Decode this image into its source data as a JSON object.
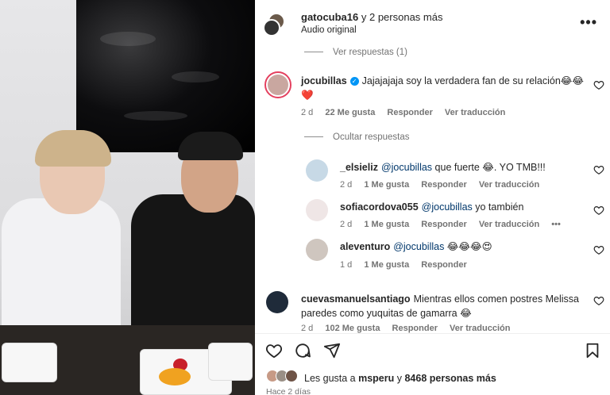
{
  "header": {
    "username": "gatocuba16",
    "others": "y 2 personas más",
    "audio": "Audio original",
    "more": "•••"
  },
  "toggles": {
    "view_replies": "Ver respuestas (1)",
    "hide_replies": "Ocultar respuestas"
  },
  "comments": [
    {
      "user": "jocubillas",
      "text": "Jajajajaja soy la verdadera fan de su relación😂😂",
      "text2": "❤️",
      "time": "2 d",
      "likes": "22 Me gusta",
      "reply": "Responder",
      "translate": "Ver traducción"
    },
    {
      "user": "_elsieliz",
      "mention": "@jocubillas",
      "text": " que fuerte 😂. YO TMB!!!",
      "time": "2 d",
      "likes": "1 Me gusta",
      "reply": "Responder",
      "translate": "Ver traducción"
    },
    {
      "user": "sofiacordova055",
      "mention": "@jocubillas",
      "text": " yo también",
      "time": "2 d",
      "likes": "1 Me gusta",
      "reply": "Responder",
      "translate": "Ver traducción",
      "more": "•••"
    },
    {
      "user": "aleventuro",
      "mention": "@jocubillas",
      "text": " 😂😂😂😍",
      "time": "1 d",
      "likes": "1 Me gusta",
      "reply": "Responder"
    },
    {
      "user": "cuevasmanuelsantiago",
      "text": "Mientras ellos comen postres Melissa paredes como yuquitas de gamarra 😂",
      "time": "2 d",
      "likes": "102 Me gusta",
      "reply": "Responder",
      "translate": "Ver traducción"
    }
  ],
  "footer": {
    "likes_prefix": "Les gusta a ",
    "likes_user": "msperu",
    "likes_mid": " y ",
    "likes_count": "8468 personas más",
    "time_ago": "Hace 2 días"
  },
  "colors": {
    "mention": "#00376b",
    "verified": "#0095f6",
    "muted": "#737373"
  }
}
